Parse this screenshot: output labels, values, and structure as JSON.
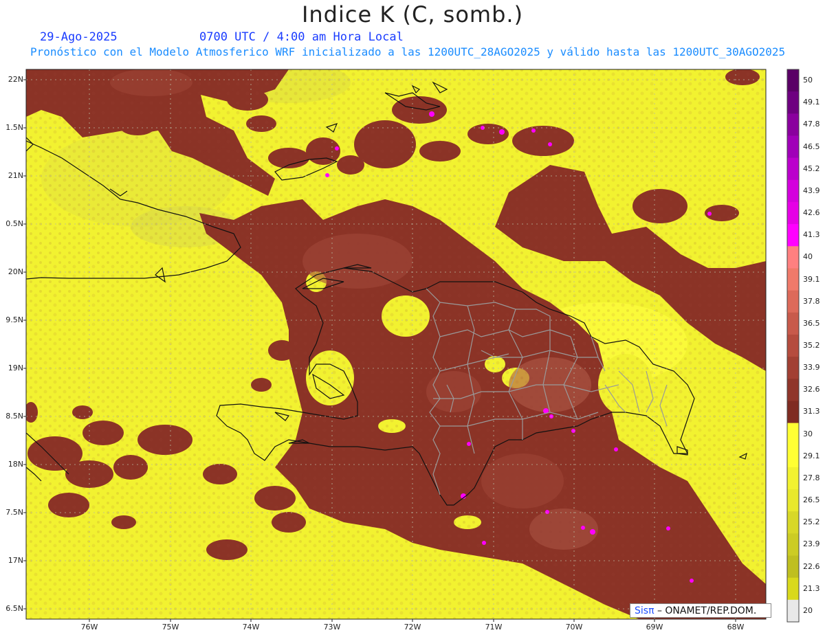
{
  "title": "Indice K (C, somb.)",
  "date": "29-Ago-2025",
  "time": "0700 UTC / 4:00 am Hora Local",
  "description": "Pronóstico con el Modelo Atmosferico WRF inicializado a las 1200UTC_28AGO2025 y válido hasta las  1200UTC_30AGO2025",
  "credit": {
    "brand": "Sisπ",
    "text": " – ONAMET/REP.DOM."
  },
  "lat_labels": [
    "22N",
    "1.5N",
    "21N",
    "0.5N",
    "20N",
    "9.5N",
    "19N",
    "8.5N",
    "18N",
    "7.5N",
    "17N",
    "6.5N"
  ],
  "lon_labels": [
    "76W",
    "75W",
    "74W",
    "73W",
    "72W",
    "71W",
    "70W",
    "69W",
    "68W"
  ],
  "colorbar": {
    "labels": [
      "50",
      "49.1",
      "47.8",
      "46.5",
      "45.2",
      "43.9",
      "42.6",
      "41.3",
      "40",
      "39.1",
      "37.8",
      "36.5",
      "35.2",
      "33.9",
      "32.6",
      "31.3",
      "30",
      "29.1",
      "27.8",
      "26.5",
      "25.2",
      "23.9",
      "22.6",
      "21.3",
      "20"
    ],
    "colors": [
      "#5a0066",
      "#6e0080",
      "#8a009e",
      "#a000b8",
      "#bb00cc",
      "#d400dd",
      "#e600e6",
      "#ff00ff",
      "#ff8080",
      "#f07a6a",
      "#dd6a5a",
      "#c85a4b",
      "#b54c3e",
      "#a24033",
      "#90362a",
      "#7f2c22",
      "#ffff33",
      "#ffff33",
      "#f2f230",
      "#e8e82c",
      "#d8d828",
      "#cccc24",
      "#bfbf20",
      "#d9d91c",
      "#e8e8e8"
    ]
  }
}
